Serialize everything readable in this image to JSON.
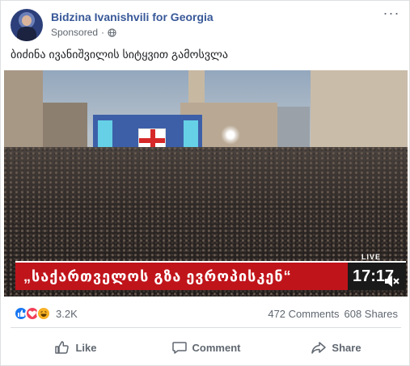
{
  "post": {
    "page_name": "Bidzina Ivanishvili for Georgia",
    "sponsored_label": "Sponsored",
    "sponsored_separator": "·",
    "more_options": "···",
    "text": "ბიძინა ივანიშვილის სიტყვით გამოსვლა"
  },
  "video": {
    "headline": "„საქართველოს გზა ევროპისკენ“",
    "live_label": "LIVE",
    "clock": "17:17"
  },
  "engagement": {
    "reaction_icons": [
      "like-icon",
      "love-icon",
      "haha-icon"
    ],
    "reaction_count": "3.2K",
    "comments": "472 Comments",
    "shares": "608 Shares"
  },
  "actions": {
    "like_label": "Like",
    "comment_label": "Comment",
    "share_label": "Share"
  },
  "colors": {
    "page_name": "#385898",
    "banner_red": "#c0141b",
    "like_blue": "#1877f2",
    "love_red": "#f33e58",
    "haha_yellow": "#f7b125",
    "secondary_text": "#606770"
  }
}
